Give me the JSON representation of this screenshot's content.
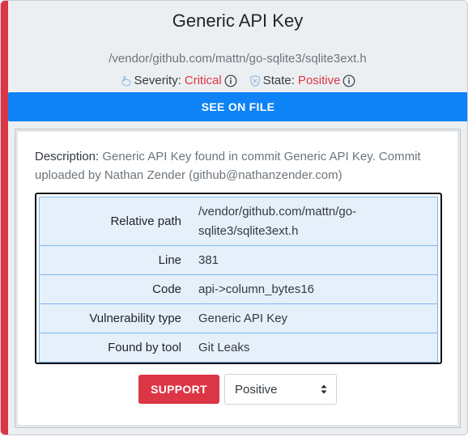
{
  "finding": {
    "title": "Generic API Key",
    "file_path": "/vendor/github.com/mattn/go-sqlite3/sqlite3ext.h",
    "severity_label": "Severity:",
    "severity_value": "Critical",
    "state_label": "State:",
    "state_value": "Positive"
  },
  "actions": {
    "see_on_file_label": "SEE ON FILE",
    "support_label": "SUPPORT"
  },
  "description": {
    "label": "Description:",
    "text": "Generic API Key found in commit Generic API Key. Commit uploaded by Nathan Zender (github@nathanzender.com)"
  },
  "details": [
    {
      "key": "Relative path",
      "value": "/vendor/github.com/mattn/go-sqlite3/sqlite3ext.h"
    },
    {
      "key": "Line",
      "value": "381"
    },
    {
      "key": "Code",
      "value": "api->column_bytes16"
    },
    {
      "key": "Vulnerability type",
      "value": "Generic API Key"
    },
    {
      "key": "Found by tool",
      "value": "Git Leaks"
    }
  ],
  "state_select": {
    "selected": "Positive"
  },
  "icons": {
    "severity": "hand-pointer-icon",
    "severity_info": "info-circle-icon",
    "state": "shield-icon",
    "state_info": "info-circle-icon",
    "select_caret": "sort-caret-icon"
  },
  "colors": {
    "accent": "#dc3545",
    "primary": "#0d83f5",
    "row_bg": "#e6f0fa",
    "row_border": "#7ab8f2"
  }
}
